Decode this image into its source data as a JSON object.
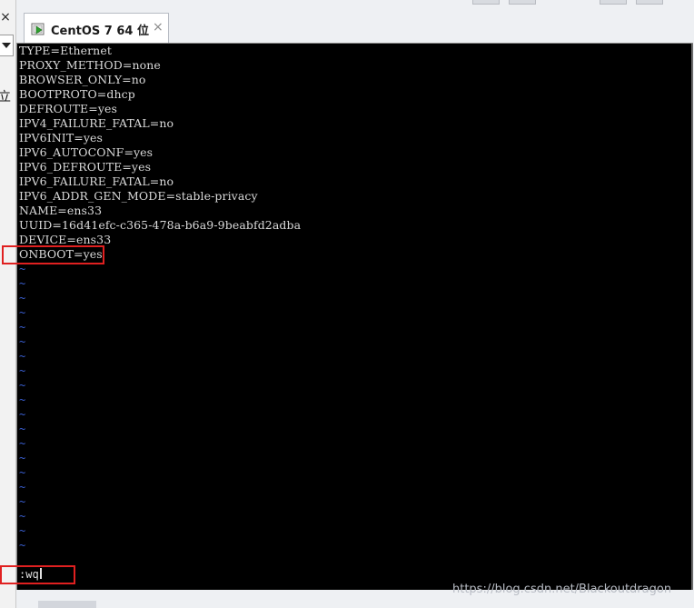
{
  "left_panel": {
    "close_glyph": "×",
    "partial_char": "立"
  },
  "tab": {
    "label": "CentOS 7 64 位",
    "close_glyph": "×"
  },
  "terminal": {
    "config_lines": [
      "TYPE=Ethernet",
      "PROXY_METHOD=none",
      "BROWSER_ONLY=no",
      "BOOTPROTO=dhcp",
      "DEFROUTE=yes",
      "IPV4_FAILURE_FATAL=no",
      "IPV6INIT=yes",
      "IPV6_AUTOCONF=yes",
      "IPV6_DEFROUTE=yes",
      "IPV6_FAILURE_FATAL=no",
      "IPV6_ADDR_GEN_MODE=stable-privacy",
      "NAME=ens33",
      "UUID=16d41efc-c365-478a-b6a9-9beabfd2adba",
      "DEVICE=ens33",
      "ONBOOT=yes"
    ],
    "empty_line_marker": "~",
    "command": ":wq"
  },
  "watermark": "https://blog.csdn.net/Blackoutdragon",
  "colors": {
    "terminal_bg": "#000000",
    "terminal_text": "#d9d9d9",
    "tilde": "#3a5fd0",
    "annotation": "#e02020"
  }
}
